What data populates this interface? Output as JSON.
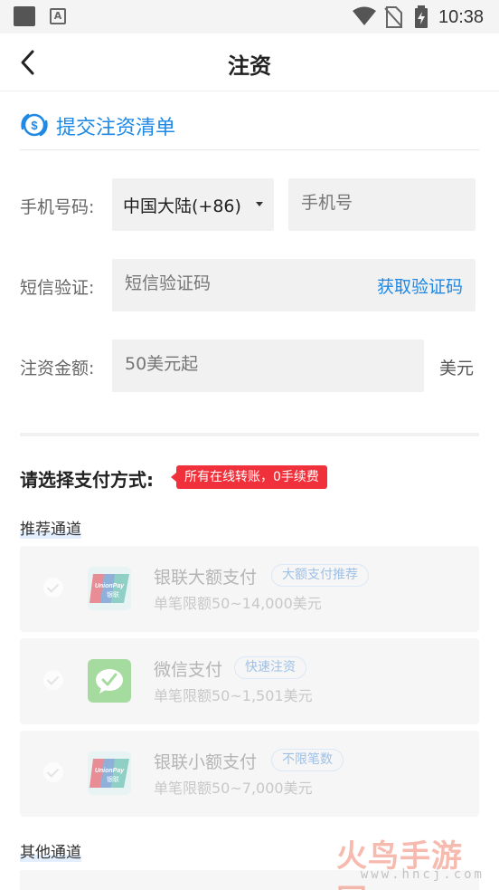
{
  "status_bar": {
    "time": "10:38"
  },
  "nav": {
    "title": "注资"
  },
  "submit_list": {
    "label": "提交注资清单"
  },
  "form": {
    "phone_label": "手机号码:",
    "country_value": "中国大陆(+86)",
    "phone_placeholder": "手机号",
    "sms_label": "短信验证:",
    "sms_placeholder": "短信验证码",
    "get_code": "获取验证码",
    "amount_label": "注资金额:",
    "amount_placeholder": "50美元起",
    "amount_unit": "美元"
  },
  "payment": {
    "title": "请选择支付方式:",
    "fee_badge": "所有在线转账，0手续费",
    "recommended_label": "推荐通道",
    "other_label": "其他通道",
    "channels": [
      {
        "name": "银联大额支付",
        "tag": "大额支付推荐",
        "limit": "单笔限额50~14,000美元",
        "icon": "unionpay-icon"
      },
      {
        "name": "微信支付",
        "tag": "快速注资",
        "limit": "单笔限额50~1,501美元",
        "icon": "wechat-pay-icon"
      },
      {
        "name": "银联小额支付",
        "tag": "不限笔数",
        "limit": "单笔限额50~7,000美元",
        "icon": "unionpay-icon"
      }
    ]
  },
  "unionpay_logo_text": "UnionPay 银联",
  "watermark": {
    "main": "火鸟手游网",
    "sub": "www.hncj.com"
  },
  "colors": {
    "accent": "#1e88e5",
    "badge": "#f0303a"
  }
}
